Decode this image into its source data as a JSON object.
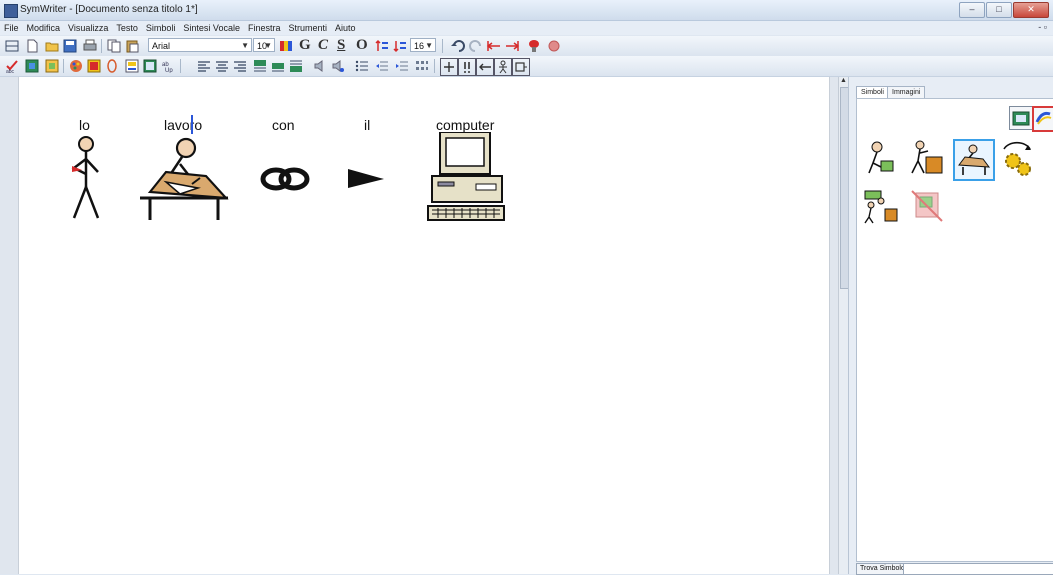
{
  "window": {
    "title": "SymWriter - [Documento senza titolo 1*]",
    "buttons": {
      "minimize": "–",
      "maximize": "□",
      "close": "✕"
    }
  },
  "menu": [
    "File",
    "Modifica",
    "Visualizza",
    "Testo",
    "Simboli",
    "Sintesi Vocale",
    "Finestra",
    "Strumenti",
    "Aiuto"
  ],
  "toolbar": {
    "font_name": "Arial",
    "font_size": "10",
    "format": {
      "bold": "G",
      "italic": "C",
      "underline": "S",
      "outline": "O"
    },
    "symbol_size": "16",
    "accent_colors": {
      "red": "#d62b2b",
      "blue": "#2b56d8",
      "yellow": "#f0c419"
    }
  },
  "document": {
    "words": [
      {
        "text": "lo",
        "symbol": "person-pointing-to-self-icon"
      },
      {
        "text": "lavoro",
        "symbol": "person-writing-at-desk-icon"
      },
      {
        "text": "con",
        "symbol": "linked-rings-icon"
      },
      {
        "text": "il",
        "symbol": "arrow-pointer-icon"
      },
      {
        "text": "computer",
        "symbol": "desktop-computer-icon"
      }
    ]
  },
  "panel": {
    "tabs": [
      "Simboli",
      "Immagini"
    ],
    "active_tab": "Simboli",
    "find_symbol_label": "Trova Simbolo",
    "symbols": [
      "person-working-icon",
      "person-carrying-box-icon",
      "person-writing-icon",
      "gears-rotating-icon",
      "people-working-icon",
      "crossed-out-picture-icon"
    ],
    "selected_symbol_index": 2
  }
}
